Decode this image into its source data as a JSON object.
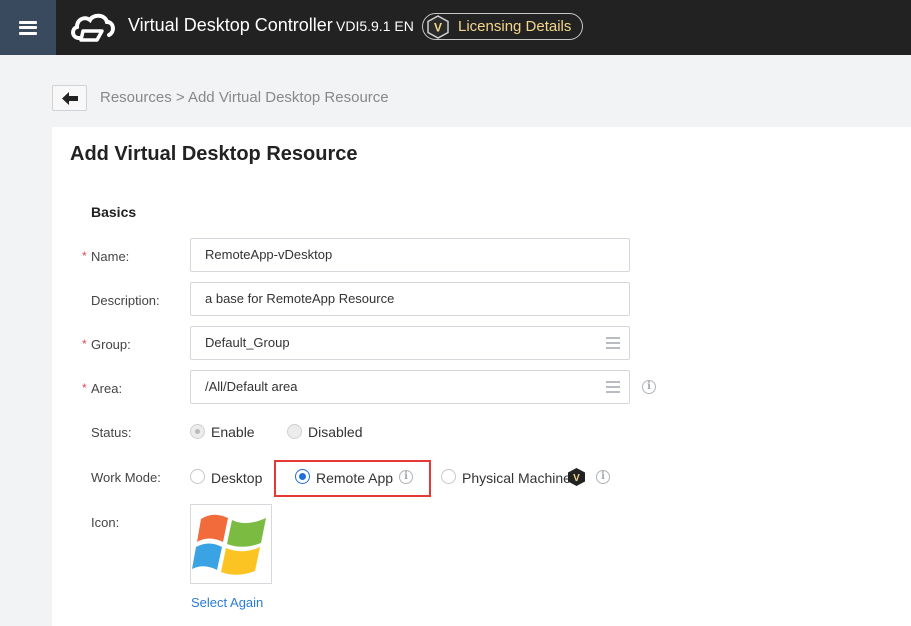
{
  "header": {
    "title": "Virtual Desktop Controller",
    "version": "VDI5.9.1 EN",
    "licensing_label": "Licensing Details",
    "menu_icon": "hamburger-menu-icon",
    "logo_icon": "cloud-logo-icon",
    "badge_letter": "V",
    "accent_color": "#f3d68b"
  },
  "breadcrumb": {
    "text": "Resources > Add Virtual Desktop Resource",
    "back_icon": "arrow-left-icon"
  },
  "page": {
    "title": "Add Virtual Desktop Resource",
    "section_title": "Basics"
  },
  "form": {
    "required_mark": "*",
    "name": {
      "label": "Name:",
      "value": "RemoteApp-vDesktop"
    },
    "description": {
      "label": "Description:",
      "value": "a base for RemoteApp Resource"
    },
    "group": {
      "label": "Group:",
      "value": "Default_Group"
    },
    "area": {
      "label": "Area:",
      "value": "/All/Default area"
    },
    "status": {
      "label": "Status:",
      "options": [
        "Enable",
        "Disabled"
      ],
      "selected": "Enable"
    },
    "work_mode": {
      "label": "Work Mode:",
      "options": [
        "Desktop",
        "Remote App",
        "Physical Machine"
      ],
      "selected": "Remote App",
      "highlight_color": "#e53935"
    },
    "icon": {
      "label": "Icon:",
      "image": "windows-logo-icon",
      "select_again_label": "Select Again"
    }
  }
}
